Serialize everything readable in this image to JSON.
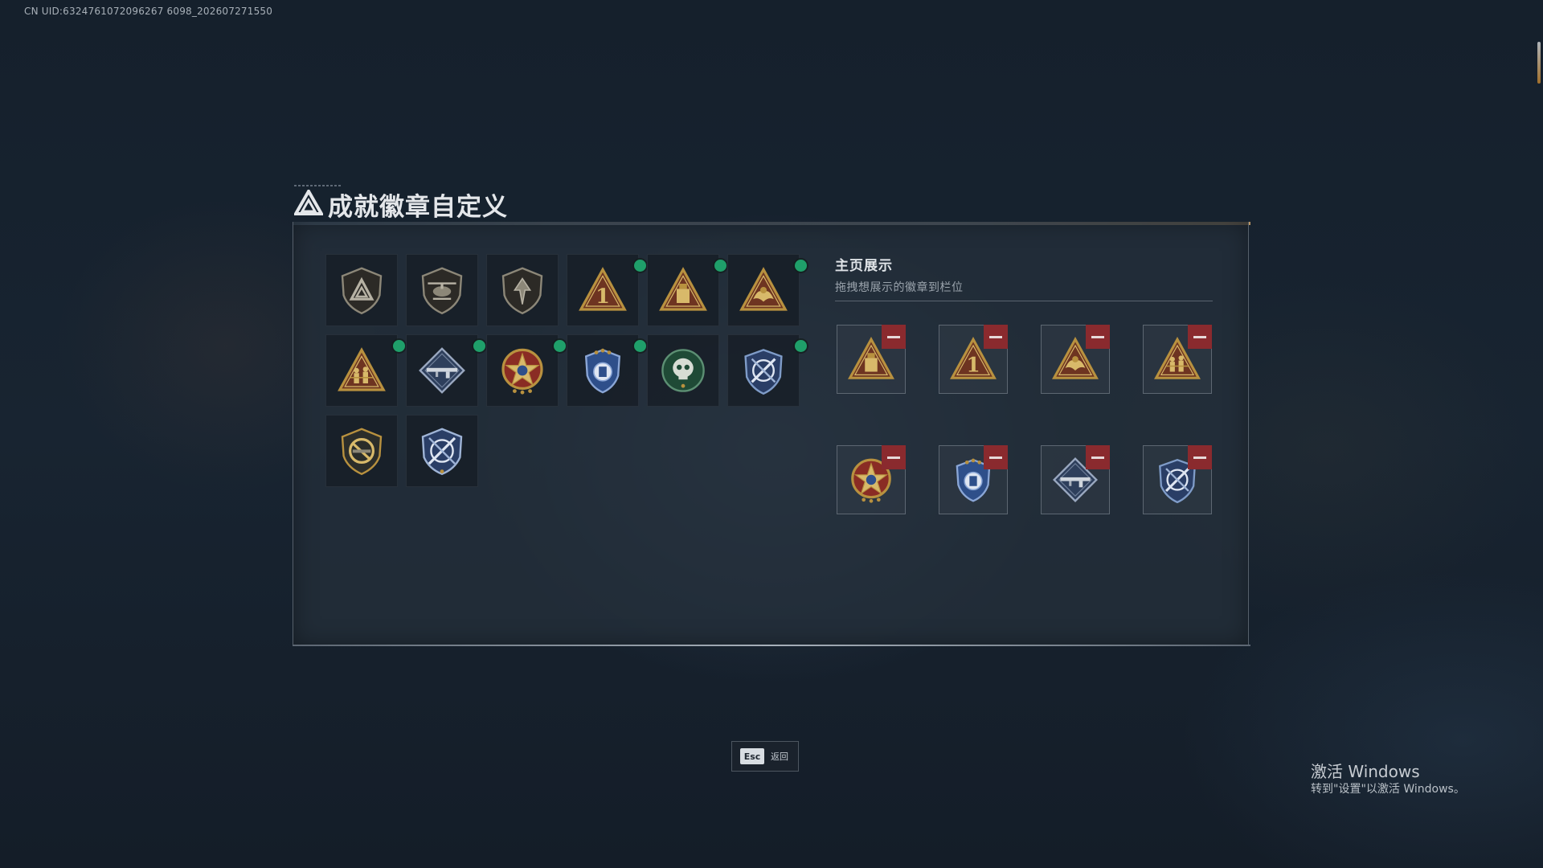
{
  "uid": "CN UID:6324761072096267 6098_202607271550",
  "title": "成就徽章自定义",
  "inventory": {
    "badges": [
      {
        "icon": "triangle-shield-badge-icon",
        "new": false
      },
      {
        "icon": "helicopter-shield-badge-icon",
        "new": false
      },
      {
        "icon": "wing-shield-badge-icon",
        "new": false
      },
      {
        "icon": "number-one-triangle-badge-icon",
        "new": true
      },
      {
        "icon": "supply-crate-triangle-badge-icon",
        "new": true
      },
      {
        "icon": "eagle-triangle-badge-icon",
        "new": true
      },
      {
        "icon": "soldiers-triangle-badge-icon",
        "new": true
      },
      {
        "icon": "rifle-diamond-badge-icon",
        "new": true
      },
      {
        "icon": "gold-star-medal-icon",
        "new": true
      },
      {
        "icon": "blue-shield-medal-icon",
        "new": true
      },
      {
        "icon": "green-skull-badge-icon",
        "new": false
      },
      {
        "icon": "crossed-arrows-blue-badge-icon",
        "new": true
      },
      {
        "icon": "no-rifle-shield-badge-icon",
        "new": false
      },
      {
        "icon": "crossed-arrows-blue-badge-2-icon",
        "new": false
      }
    ]
  },
  "showcase": {
    "title": "主页展示",
    "subtitle": "拖拽想展示的徽章到栏位",
    "slots": [
      {
        "icon": "supply-crate-triangle-badge-icon"
      },
      {
        "icon": "number-one-triangle-badge-icon"
      },
      {
        "icon": "eagle-triangle-badge-icon"
      },
      {
        "icon": "soldiers-triangle-badge-icon"
      },
      {
        "icon": "gold-star-medal-icon"
      },
      {
        "icon": "blue-shield-medal-icon"
      },
      {
        "icon": "rifle-diamond-badge-icon"
      },
      {
        "icon": "crossed-arrows-blue-badge-icon"
      }
    ]
  },
  "esc": {
    "key": "Esc",
    "label": "返回"
  },
  "activation": {
    "title": "激活 Windows",
    "subtitle": "转到\"设置\"以激活 Windows。"
  },
  "colors": {
    "new_dot": "#1f9f6a",
    "remove": "#8a2a2e",
    "gold": "#b8913f",
    "bronze": "#7a3a22",
    "blue": "#2e4f8a"
  }
}
